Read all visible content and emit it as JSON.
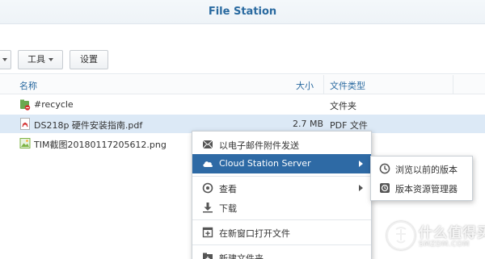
{
  "window": {
    "title": "File Station"
  },
  "toolbar": {
    "tools_label": "工具",
    "settings_label": "设置"
  },
  "columns": {
    "name": "名称",
    "size": "大小",
    "type": "文件类型"
  },
  "files": [
    {
      "name": "#recycle",
      "size": "",
      "type": "文件夹",
      "icon": "recycle-folder-icon",
      "selected": false
    },
    {
      "name": "DS218p 硬件安装指南.pdf",
      "size": "2.7 MB",
      "type": "PDF 文件",
      "icon": "pdf-file-icon",
      "selected": true
    },
    {
      "name": "TIM截图20180117205612.png",
      "size": "",
      "type": "",
      "icon": "image-file-icon",
      "selected": false
    }
  ],
  "context_menu": {
    "items": [
      {
        "label": "以电子邮件附件发送",
        "icon": "email-icon"
      },
      {
        "label": "Cloud Station Server",
        "icon": "cloud-icon",
        "active": true,
        "submenu": true
      },
      {
        "label": "查看",
        "icon": "eye-icon",
        "submenu": true
      },
      {
        "label": "下载",
        "icon": "download-icon"
      },
      {
        "label": "在新窗口打开文件",
        "icon": "new-window-icon"
      },
      {
        "label": "新建文件夹",
        "icon": "new-folder-icon"
      }
    ]
  },
  "submenu": {
    "items": [
      {
        "label": "浏览以前的版本",
        "icon": "clock-icon"
      },
      {
        "label": "版本资源管理器",
        "icon": "version-explorer-icon"
      }
    ]
  },
  "watermark": {
    "cn": "什么值得买",
    "en": "SMZDM.COM"
  },
  "colors": {
    "title": "#2a6aa0",
    "selection": "#dce9f6",
    "menu_active": "#2e6aa5"
  }
}
